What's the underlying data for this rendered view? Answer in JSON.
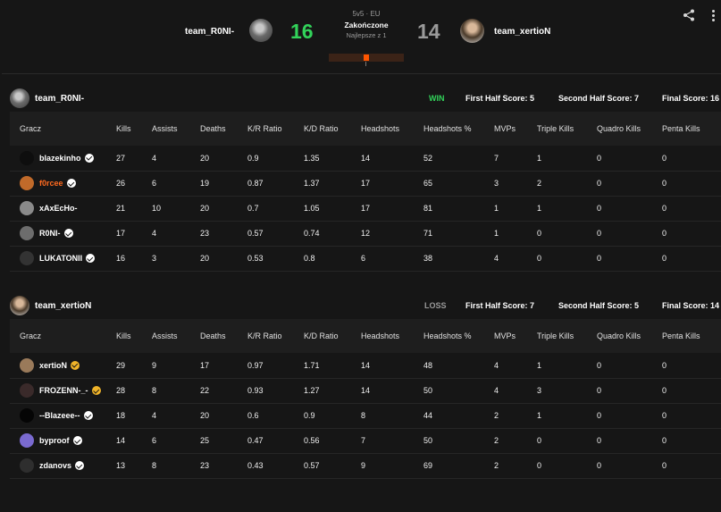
{
  "header": {
    "team_a": {
      "name": "team_R0NI-",
      "score": "16",
      "score_color": "#32d35a"
    },
    "team_b": {
      "name": "team_xertioN",
      "score": "14",
      "score_color": "#9a9a9a"
    },
    "format": "5v5 · EU",
    "status": "Zakończone",
    "best_of": "Najlepsze z 1",
    "share_icon": "share-icon",
    "menu_icon": "more-vertical-icon"
  },
  "columns": [
    "Gracz",
    "Kills",
    "Assists",
    "Deaths",
    "K/R Ratio",
    "K/D Ratio",
    "Headshots",
    "Headshots %",
    "MVPs",
    "Triple Kills",
    "Quadro Kills",
    "Penta Kills"
  ],
  "teams": [
    {
      "name": "team_R0NI-",
      "result": "WIN",
      "result_color": "#32d35a",
      "first_half": "First Half Score: 5",
      "second_half": "Second Half Score: 7",
      "final": "Final Score: 16",
      "players": [
        {
          "name": "blazekinho",
          "badge": "verified",
          "badge_color": "#ffffff",
          "name_color": "#ffffff",
          "avatar_color": "#0e0e0e",
          "stats": [
            "27",
            "4",
            "20",
            "0.9",
            "1.35",
            "14",
            "52",
            "7",
            "1",
            "0",
            "0"
          ]
        },
        {
          "name": "f0rcee",
          "badge": "verified",
          "badge_color": "#ffffff",
          "name_color": "#ff6a1f",
          "avatar_color": "#c06a2a",
          "stats": [
            "26",
            "6",
            "19",
            "0.87",
            "1.37",
            "17",
            "65",
            "3",
            "2",
            "0",
            "0"
          ]
        },
        {
          "name": "xAxEcHo-",
          "badge": "",
          "badge_color": "#ffffff",
          "name_color": "#ffffff",
          "avatar_color": "#8a8a8a",
          "stats": [
            "21",
            "10",
            "20",
            "0.7",
            "1.05",
            "17",
            "81",
            "1",
            "1",
            "0",
            "0"
          ]
        },
        {
          "name": "R0NI-",
          "badge": "verified",
          "badge_color": "#ffffff",
          "name_color": "#ffffff",
          "avatar_color": "#6d6d6d",
          "stats": [
            "17",
            "4",
            "23",
            "0.57",
            "0.74",
            "12",
            "71",
            "1",
            "0",
            "0",
            "0"
          ]
        },
        {
          "name": "LUKATONII",
          "badge": "verified",
          "badge_color": "#ffffff",
          "name_color": "#ffffff",
          "avatar_color": "#333333",
          "stats": [
            "16",
            "3",
            "20",
            "0.53",
            "0.8",
            "6",
            "38",
            "4",
            "0",
            "0",
            "0"
          ]
        }
      ]
    },
    {
      "name": "team_xertioN",
      "result": "LOSS",
      "result_color": "#9a9a9a",
      "first_half": "First Half Score: 7",
      "second_half": "Second Half Score: 5",
      "final": "Final Score: 14",
      "players": [
        {
          "name": "xertioN",
          "badge": "verified",
          "badge_color": "#f0b429",
          "name_color": "#ffffff",
          "avatar_color": "#9a7a5a",
          "stats": [
            "29",
            "9",
            "17",
            "0.97",
            "1.71",
            "14",
            "48",
            "4",
            "1",
            "0",
            "0"
          ]
        },
        {
          "name": "FROZENN-_-",
          "badge": "verified",
          "badge_color": "#f0b429",
          "name_color": "#ffffff",
          "avatar_color": "#3a2a2a",
          "stats": [
            "28",
            "8",
            "22",
            "0.93",
            "1.27",
            "14",
            "50",
            "4",
            "3",
            "0",
            "0"
          ]
        },
        {
          "name": "--Blazeee--",
          "badge": "verified",
          "badge_color": "#ffffff",
          "name_color": "#ffffff",
          "avatar_color": "#050505",
          "stats": [
            "18",
            "4",
            "20",
            "0.6",
            "0.9",
            "8",
            "44",
            "2",
            "1",
            "0",
            "0"
          ]
        },
        {
          "name": "byproof",
          "badge": "verified",
          "badge_color": "#ffffff",
          "name_color": "#ffffff",
          "avatar_color": "#7a6ad0",
          "stats": [
            "14",
            "6",
            "25",
            "0.47",
            "0.56",
            "7",
            "50",
            "2",
            "0",
            "0",
            "0"
          ]
        },
        {
          "name": "zdanovs",
          "badge": "verified",
          "badge_color": "#ffffff",
          "name_color": "#ffffff",
          "avatar_color": "#2e2e2e",
          "stats": [
            "13",
            "8",
            "23",
            "0.43",
            "0.57",
            "9",
            "69",
            "2",
            "0",
            "0",
            "0"
          ]
        }
      ]
    }
  ]
}
